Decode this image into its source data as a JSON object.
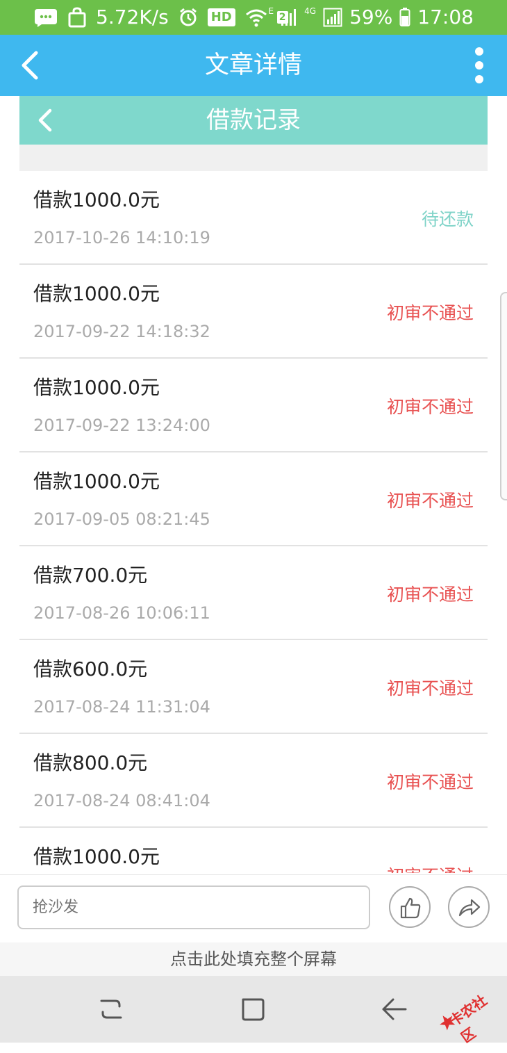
{
  "status_bar": {
    "speed": "5.72K/s",
    "hd": "HD",
    "sim": "2",
    "net_e": "E",
    "net_4g": "4G",
    "battery": "59%",
    "time": "17:08",
    "background_color": "#6cc04a"
  },
  "header": {
    "title": "文章详情",
    "background_color": "#3fb8ef"
  },
  "embedded_page": {
    "title": "借款记录",
    "header_color": "#7fd8cc"
  },
  "loan_records": [
    {
      "amount": "借款1000.0元",
      "date": "2017-10-26 14:10:19",
      "status": "待还款",
      "status_color": "#7fd3c8"
    },
    {
      "amount": "借款1000.0元",
      "date": "2017-09-22 14:18:32",
      "status": "初审不通过",
      "status_color": "#e85252"
    },
    {
      "amount": "借款1000.0元",
      "date": "2017-09-22 13:24:00",
      "status": "初审不通过",
      "status_color": "#e85252"
    },
    {
      "amount": "借款1000.0元",
      "date": "2017-09-05 08:21:45",
      "status": "初审不通过",
      "status_color": "#e85252"
    },
    {
      "amount": "借款700.0元",
      "date": "2017-08-26 10:06:11",
      "status": "初审不通过",
      "status_color": "#e85252"
    },
    {
      "amount": "借款600.0元",
      "date": "2017-08-24 11:31:04",
      "status": "初审不通过",
      "status_color": "#e85252"
    },
    {
      "amount": "借款800.0元",
      "date": "2017-08-24 08:41:04",
      "status": "初审不通过",
      "status_color": "#e85252"
    },
    {
      "amount": "借款1000.0元",
      "date": "",
      "status": "初审不通过",
      "status_color": "#e85252"
    }
  ],
  "comment_bar": {
    "placeholder": "抢沙发"
  },
  "fill_screen_banner": "点击此处填充整个屏幕",
  "watermark_text": "卡农社区",
  "icons": {
    "back": "back-arrow-icon",
    "more": "more-vertical-icon",
    "like": "thumbs-up-icon",
    "share": "share-icon",
    "recents": "recents-icon",
    "home": "home-icon",
    "nav_back": "nav-back-icon"
  }
}
